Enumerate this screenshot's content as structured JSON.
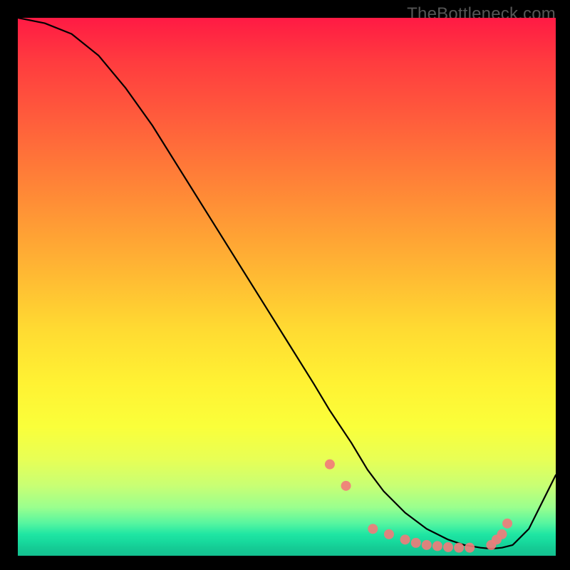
{
  "watermark": "TheBottleneck.com",
  "chart_data": {
    "type": "line",
    "title": "",
    "xlabel": "",
    "ylabel": "",
    "xlim": [
      0,
      100
    ],
    "ylim": [
      0,
      100
    ],
    "series": [
      {
        "name": "curve",
        "x": [
          0,
          5,
          10,
          15,
          20,
          25,
          30,
          35,
          40,
          45,
          50,
          55,
          58,
          62,
          65,
          68,
          72,
          76,
          80,
          83,
          86,
          88,
          90,
          92,
          95,
          100
        ],
        "y": [
          100,
          99,
          97,
          93,
          87,
          80,
          72,
          64,
          56,
          48,
          40,
          32,
          27,
          21,
          16,
          12,
          8,
          5,
          3,
          2,
          1.5,
          1.3,
          1.5,
          2,
          5,
          15
        ]
      }
    ],
    "markers": {
      "name": "dots",
      "x": [
        58,
        61,
        66,
        69,
        72,
        74,
        76,
        78,
        80,
        82,
        84,
        88,
        89,
        90,
        91
      ],
      "y": [
        17,
        13,
        5,
        4,
        3,
        2.4,
        2,
        1.8,
        1.6,
        1.5,
        1.5,
        2,
        3,
        4,
        6
      ]
    },
    "background_gradient": {
      "top": "#ff1a44",
      "mid": "#ffe233",
      "bottom": "#13c090"
    }
  }
}
